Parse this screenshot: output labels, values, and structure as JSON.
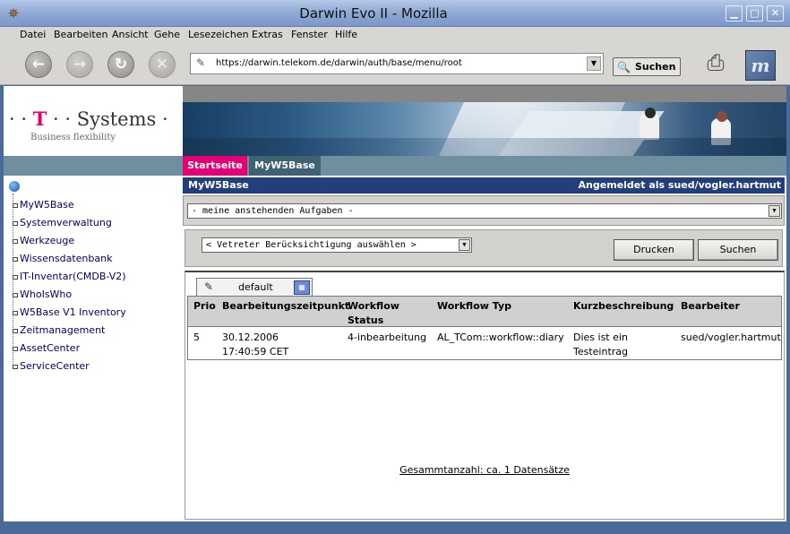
{
  "window": {
    "title": "Darwin Evo II - Mozilla"
  },
  "menubar": {
    "items": [
      "Datei",
      "Bearbeiten",
      "Ansicht",
      "Gehe",
      "Lesezeichen",
      "Extras",
      "Fenster",
      "Hilfe"
    ]
  },
  "toolbar": {
    "url": "https://darwin.telekom.de/darwin/auth/base/menu/root",
    "search_label": "Suchen"
  },
  "brand": {
    "logo_text": "T · · Systems ·",
    "tagline": "Business flexibility"
  },
  "nav_tabs": {
    "start": "Startseite",
    "myw5base": "MyW5Base"
  },
  "sidebar": {
    "items": [
      {
        "label": "MyW5Base"
      },
      {
        "label": "Systemverwaltung"
      },
      {
        "label": "Werkzeuge"
      },
      {
        "label": "Wissensdatenbank"
      },
      {
        "label": "IT-Inventar(CMDB-V2)"
      },
      {
        "label": "WhoIsWho"
      },
      {
        "label": "W5Base V1 Inventory"
      },
      {
        "label": "Zeitmanagement"
      },
      {
        "label": "AssetCenter"
      },
      {
        "label": "ServiceCenter"
      }
    ]
  },
  "main": {
    "header_title": "MyW5Base",
    "logged_in": "Angemeldet als sued/vogler.hartmut",
    "task_select": "- meine anstehenden Aufgaben -",
    "vertreter_select": "< Vetreter Berücksichtigung auswählen >",
    "print_button": "Drucken",
    "search_button": "Suchen",
    "view_tab": "default",
    "table": {
      "columns": [
        "Prio",
        "Bearbeitungszeitpunkt",
        "Workflow Status",
        "Workflow Typ",
        "Kurzbeschreibung",
        "Bearbeiter"
      ],
      "rows": [
        {
          "prio": "5",
          "zeitpunkt": "30.12.2006 17:40:59 CET",
          "status": "4-inbearbeitung",
          "typ": "AL_TCom::workflow::diary",
          "kurz": "Dies ist ein Testeintrag",
          "bearbeiter": "sued/vogler.hartmut"
        }
      ]
    },
    "total": "Gesammtanzahl: ca. 1 Datensätze"
  },
  "colors": {
    "magenta": "#e20074",
    "header_blue": "#233e7a",
    "nav_teal": "#6f8fa0"
  }
}
